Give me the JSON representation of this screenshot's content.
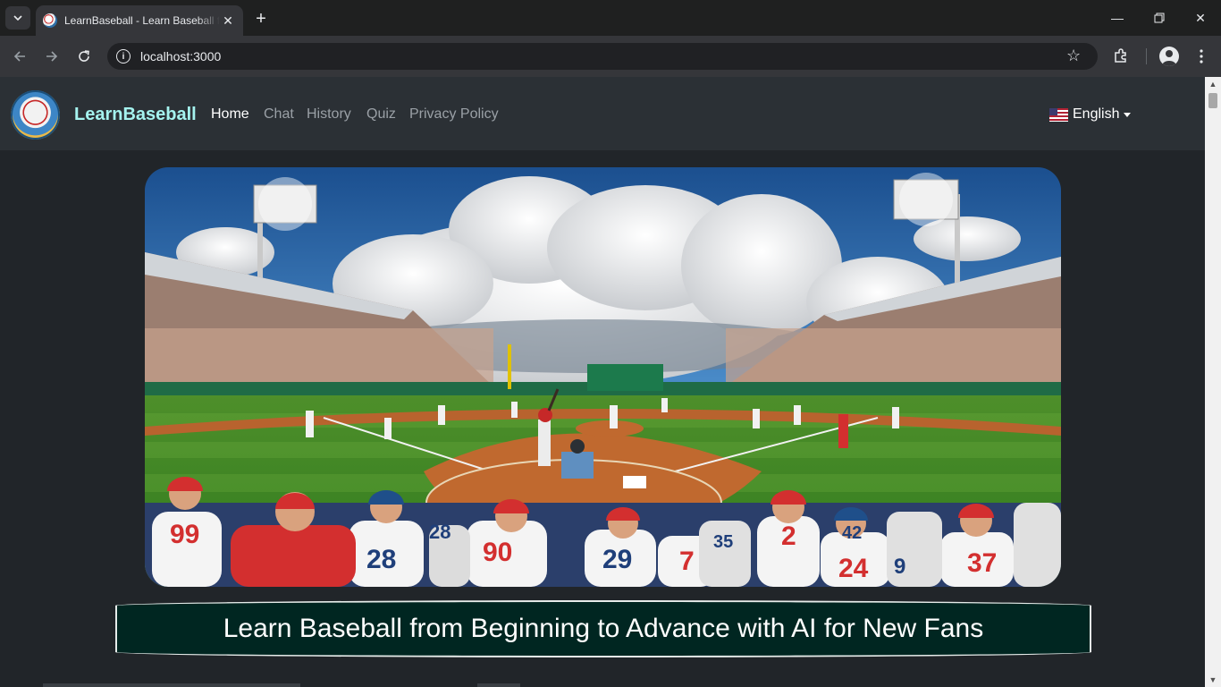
{
  "browser": {
    "tab_title": "LearnBaseball - Learn Baseball from Beginning to Advance",
    "url": "localhost:3000"
  },
  "navbar": {
    "brand": "LearnBaseball",
    "links": [
      "Home",
      "Chat",
      "History",
      "Quiz",
      "Privacy Policy"
    ],
    "active_link": "Home",
    "language": "English"
  },
  "hero": {
    "headline": "Learn Baseball from Beginning to Advance with AI for New Fans",
    "jersey_numbers": [
      "99",
      "28",
      "28",
      "90",
      "29",
      "7",
      "35",
      "2",
      "42",
      "24",
      "9",
      "37"
    ]
  },
  "colors": {
    "page_bg": "#212529",
    "navbar_bg": "#2b3035",
    "brand": "#a5f3ef",
    "headline_bg": "#002621"
  }
}
